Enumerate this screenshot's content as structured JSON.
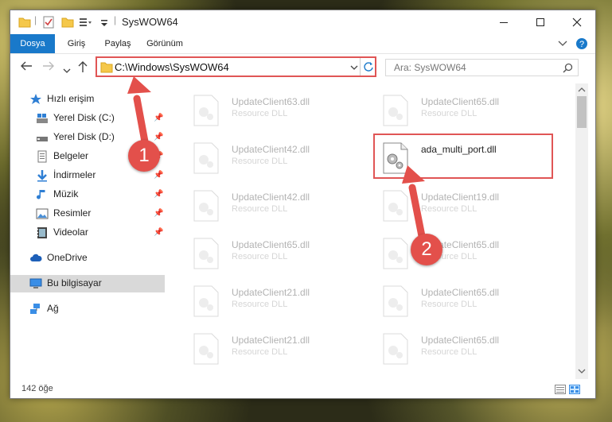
{
  "window": {
    "title": "SysWOW64",
    "minimize_icon": "minimize-icon",
    "maximize_icon": "maximize-icon",
    "close_icon": "close-icon"
  },
  "ribbon": {
    "tabs": [
      {
        "label": "Dosya",
        "active": true
      },
      {
        "label": "Giriş"
      },
      {
        "label": "Paylaş"
      },
      {
        "label": "Görünüm"
      }
    ]
  },
  "address_bar": {
    "path": "C:\\Windows\\SysWOW64",
    "search_placeholder": "Ara: SysWOW64"
  },
  "sidebar": {
    "items": [
      {
        "label": "Hızlı erişim",
        "icon": "star-icon"
      },
      {
        "label": "Yerel Disk (C:)",
        "icon": "drive-icon",
        "pinned": true
      },
      {
        "label": "Yerel Disk (D:)",
        "icon": "drive-icon",
        "pinned": true
      },
      {
        "label": "Belgeler",
        "icon": "documents-icon",
        "pinned": true
      },
      {
        "label": "İndirmeler",
        "icon": "download-icon",
        "pinned": true
      },
      {
        "label": "Müzik",
        "icon": "music-icon",
        "pinned": true
      },
      {
        "label": "Resimler",
        "icon": "pictures-icon",
        "pinned": true
      },
      {
        "label": "Videolar",
        "icon": "videos-icon",
        "pinned": true
      },
      {
        "label": "OneDrive",
        "icon": "cloud-icon"
      },
      {
        "label": "Bu bilgisayar",
        "icon": "computer-icon",
        "selected": true
      },
      {
        "label": "Ağ",
        "icon": "network-icon"
      }
    ]
  },
  "files": {
    "left_column": [
      {
        "name": "UpdateClient63.dll",
        "type": "Resource DLL"
      },
      {
        "name": "UpdateClient42.dll",
        "type": "Resource DLL"
      },
      {
        "name": "UpdateClient42.dll",
        "type": "Resource DLL"
      },
      {
        "name": "UpdateClient65.dll",
        "type": "Resource DLL"
      },
      {
        "name": "UpdateClient21.dll",
        "type": "Resource DLL"
      },
      {
        "name": "UpdateClient21.dll",
        "type": "Resource DLL"
      }
    ],
    "right_column": [
      {
        "name": "UpdateClient65.dll",
        "type": "Resource DLL"
      },
      {
        "name": "ada_multi_port.dll",
        "type": "",
        "highlighted": true
      },
      {
        "name": "UpdateClient19.dll",
        "type": "Resource DLL"
      },
      {
        "name": "UpdateClient65.dll",
        "type": "Resource DLL"
      },
      {
        "name": "UpdateClient65.dll",
        "type": "Resource DLL"
      },
      {
        "name": "UpdateClient65.dll",
        "type": "Resource DLL"
      }
    ]
  },
  "status": {
    "item_count": "142 öğe"
  },
  "annotations": {
    "step1": "1",
    "step2": "2",
    "color": "#e3504b"
  }
}
